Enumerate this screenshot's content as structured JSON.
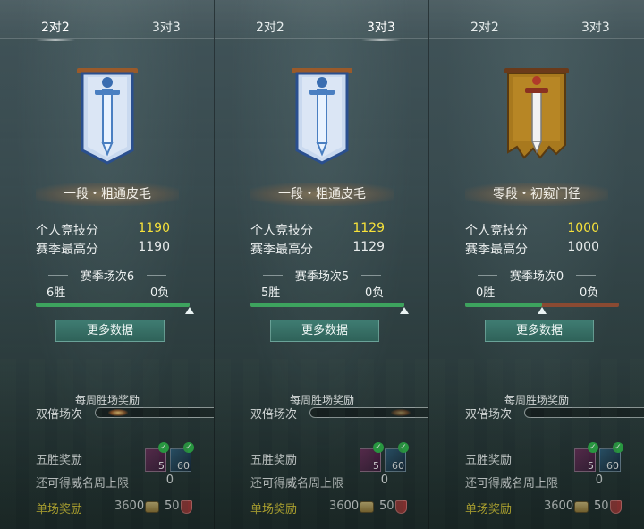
{
  "panels": [
    {
      "tabs": {
        "left": "2对2",
        "right": "3对3",
        "active": "left"
      },
      "emblem": "blue-banner-sword-icon",
      "rank_title": "一段・粗通皮毛",
      "personal_score_label": "个人竞技分",
      "personal_score": "1190",
      "season_best_label": "赛季最高分",
      "season_best": "1190",
      "season_games": "赛季场次6",
      "wins": "6胜",
      "losses": "0负",
      "win_fraction": 1.0,
      "more_button": "更多数据",
      "weekly_title": "每周胜场奖励",
      "double_label": "双倍场次",
      "double_count": "0",
      "five_win_label": "五胜奖励",
      "item_counts": [
        "5",
        "60"
      ],
      "fame_label": "还可得威名周上限",
      "fame_value": "0",
      "single_label": "单场奖励",
      "single_coin": "3600",
      "single_shield": "50"
    },
    {
      "tabs": {
        "left": "2对2",
        "right": "3对3",
        "active": "right"
      },
      "emblem": "blue-banner-sword-icon",
      "rank_title": "一段・粗通皮毛",
      "personal_score_label": "个人竞技分",
      "personal_score": "1129",
      "season_best_label": "赛季最高分",
      "season_best": "1129",
      "season_games": "赛季场次5",
      "wins": "5胜",
      "losses": "0负",
      "win_fraction": 1.0,
      "more_button": "更多数据",
      "weekly_title": "每周胜场奖励",
      "double_label": "双倍场次",
      "double_count": "0",
      "five_win_label": "五胜奖励",
      "item_counts": [
        "5",
        "60"
      ],
      "fame_label": "还可得威名周上限",
      "fame_value": "0",
      "single_label": "单场奖励",
      "single_coin": "3600",
      "single_shield": "50"
    },
    {
      "tabs": {
        "left": "2对2",
        "right": "3对3",
        "active": "none"
      },
      "emblem": "gold-banner-sword-icon",
      "rank_title": "零段・初窥门径",
      "personal_score_label": "个人竞技分",
      "personal_score": "1000",
      "season_best_label": "赛季最高分",
      "season_best": "1000",
      "season_games": "赛季场次0",
      "wins": "0胜",
      "losses": "0负",
      "win_fraction": 0.5,
      "more_button": "更多数据",
      "weekly_title": "每周胜场奖励",
      "double_label": "双倍场次",
      "double_count": "0",
      "five_win_label": "五胜奖励",
      "item_counts": [
        "5",
        "60"
      ],
      "fame_label": "还可得威名周上限",
      "fame_value": "0",
      "single_label": "单场奖励",
      "single_coin": "3600",
      "single_shield": "50"
    }
  ],
  "colors": {
    "highlight_score": "#f7e23a",
    "win_bar": "#3da35e",
    "loss_bar": "#8a4a32",
    "button": "#3f7c72"
  }
}
